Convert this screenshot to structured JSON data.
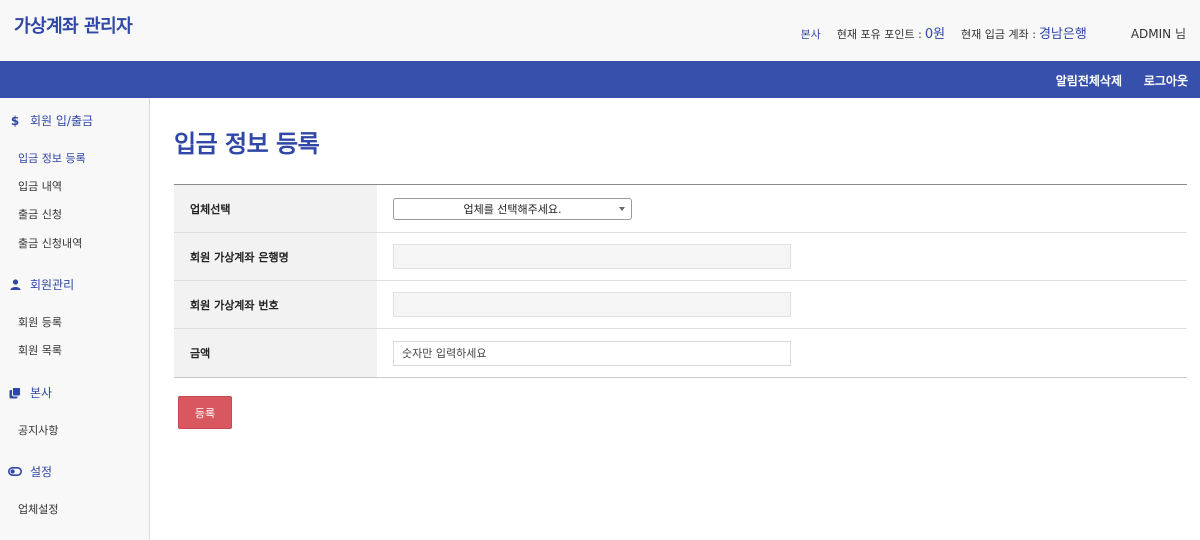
{
  "header": {
    "brand": "가상계좌 관리자",
    "branch": "본사",
    "points_label": "현재 포유 포인트 :",
    "points_value": "0원",
    "account_label": "현재 입금 계좌 :",
    "account_value": "경남은행",
    "admin": "ADMIN 님"
  },
  "nav": {
    "alert_delete": "알림전체삭제",
    "logout": "로그아웃"
  },
  "sidebar": {
    "sections": [
      {
        "icon": "dollar-icon",
        "label": "회원 입/출금",
        "items": [
          "입금 정보 등록",
          "입금 내역",
          "출금 신청",
          "출금 신청내역"
        ]
      },
      {
        "icon": "user-icon",
        "label": "회원관리",
        "items": [
          "회원 등록",
          "회원 목록"
        ]
      },
      {
        "icon": "copy-icon",
        "label": "본사",
        "items": [
          "공지사항"
        ]
      },
      {
        "icon": "toggle-icon",
        "label": "설정",
        "items": [
          "업체설정"
        ]
      }
    ]
  },
  "page": {
    "title": "입금 정보 등록"
  },
  "form": {
    "company_label": "업체선택",
    "company_select": "업체를 선택해주세요.",
    "bank_label": "회원 가상계좌 은행명",
    "account_label": "회원 가상계좌 번호",
    "amount_label": "금액",
    "amount_placeholder": "숫자만 입력하세요",
    "submit_label": "등록"
  },
  "colors": {
    "brand": "#2f47a6",
    "navbar": "#3650ab",
    "submit": "#d9575e"
  }
}
